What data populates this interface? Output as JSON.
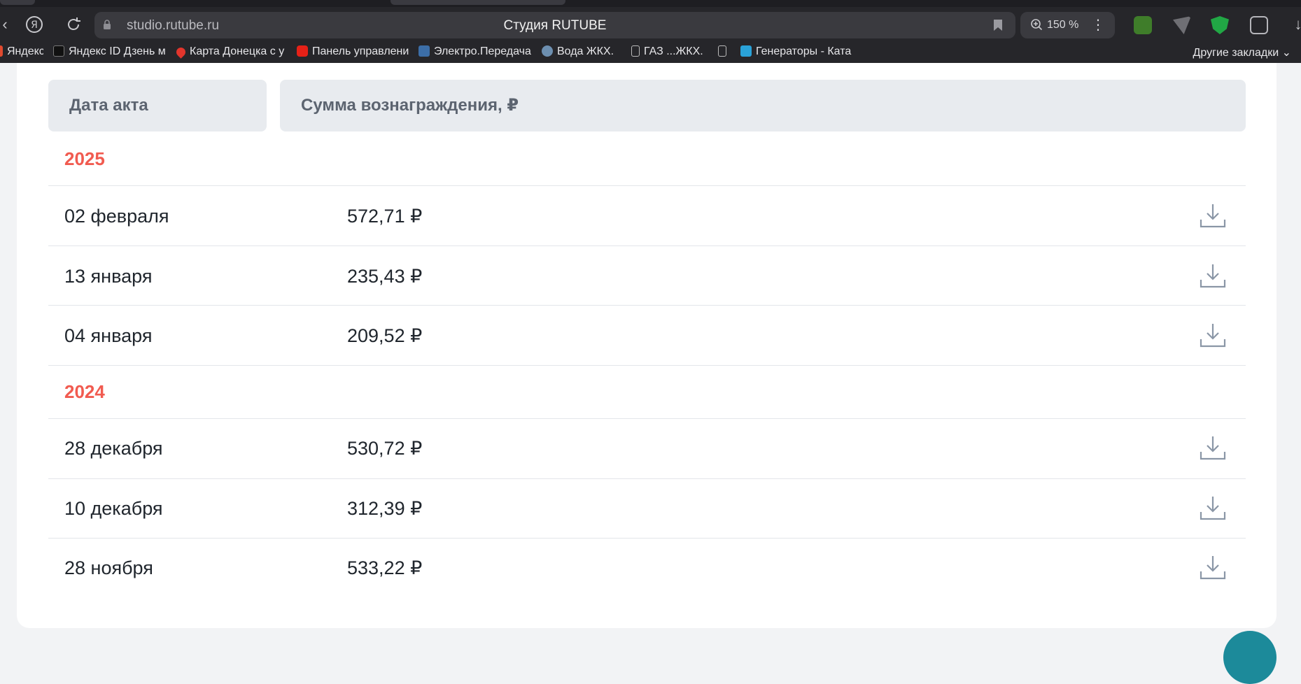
{
  "browser": {
    "url": "studio.rutube.ru",
    "title": "Студия RUTUBE",
    "zoom": "150 %",
    "bookmarks": [
      {
        "label": "Яндекс",
        "icon": "yandex-icon",
        "color": "#e04a2f"
      },
      {
        "label": "Яндекс ID Дзень м",
        "icon": "yandex-id-icon",
        "color": "#111111"
      },
      {
        "label": "Карта Донецка с у",
        "icon": "map-pin-icon",
        "color": "#e2352c"
      },
      {
        "label": "Панель управлени",
        "icon": "youtube-icon",
        "color": "#e62117"
      },
      {
        "label": "Электро.Передача",
        "icon": "electro-icon",
        "color": "#3c6ea8"
      },
      {
        "label": "Вода  ЖКХ.",
        "icon": "water-icon",
        "color": "#6d8fb0"
      },
      {
        "label": "ГАЗ ...ЖКХ.",
        "icon": "page-icon",
        "color": "#bbbbbb"
      },
      {
        "label": "",
        "icon": "page-icon",
        "color": "#bbbbbb"
      },
      {
        "label": "Генераторы - Ката",
        "icon": "generator-icon",
        "color": "#2aa2d8"
      }
    ],
    "other_bookmarks": "Другие закладки"
  },
  "table": {
    "header_date": "Дата акта",
    "header_sum": "Сумма вознаграждения, ₽",
    "groups": [
      {
        "year": "2025",
        "rows": [
          {
            "date": "02 февраля",
            "sum": "572,71 ₽"
          },
          {
            "date": "13 января",
            "sum": "235,43 ₽"
          },
          {
            "date": "04 января",
            "sum": "209,52 ₽"
          }
        ]
      },
      {
        "year": "2024",
        "rows": [
          {
            "date": "28 декабря",
            "sum": "530,72 ₽"
          },
          {
            "date": "10 декабря",
            "sum": "312,39 ₽"
          },
          {
            "date": "28 ноября",
            "sum": "533,22 ₽"
          }
        ]
      }
    ]
  },
  "colors": {
    "year_accent": "#f15b50",
    "header_bg": "#e8ebef",
    "download_icon": "#8a96a6"
  }
}
